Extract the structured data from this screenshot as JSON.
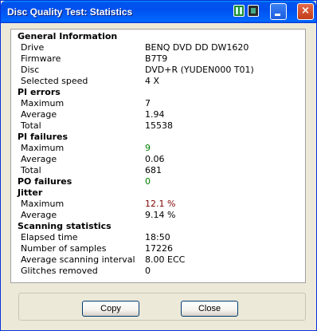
{
  "window": {
    "title": "Disc Quality Test: Statistics",
    "close_glyph": "×"
  },
  "rows": [
    {
      "type": "section",
      "label": "General Information"
    },
    {
      "type": "item",
      "label": "Drive",
      "value": "BENQ     DVD DD DW1620"
    },
    {
      "type": "item",
      "label": "Firmware",
      "value": "B7T9"
    },
    {
      "type": "item",
      "label": "Disc",
      "value": "DVD+R (YUDEN000 T01)"
    },
    {
      "type": "item",
      "label": "Selected speed",
      "value": "4 X"
    },
    {
      "type": "section",
      "label": "PI errors"
    },
    {
      "type": "item",
      "label": "Maximum",
      "value": "7"
    },
    {
      "type": "item",
      "label": "Average",
      "value": "1.94"
    },
    {
      "type": "item",
      "label": "Total",
      "value": "15538"
    },
    {
      "type": "section",
      "label": "PI failures"
    },
    {
      "type": "item",
      "label": "Maximum",
      "value": "9",
      "color": "green"
    },
    {
      "type": "item",
      "label": "Average",
      "value": "0.06"
    },
    {
      "type": "item",
      "label": "Total",
      "value": "681"
    },
    {
      "type": "section",
      "label": "PO failures",
      "value": "0",
      "color": "green"
    },
    {
      "type": "section",
      "label": "Jitter"
    },
    {
      "type": "item",
      "label": "Maximum",
      "value": "12.1 %",
      "color": "red"
    },
    {
      "type": "item",
      "label": "Average",
      "value": "9.14 %"
    },
    {
      "type": "section",
      "label": "Scanning statistics"
    },
    {
      "type": "item",
      "label": "Elapsed time",
      "value": "18:50"
    },
    {
      "type": "item",
      "label": "Number of samples",
      "value": "17226"
    },
    {
      "type": "item",
      "label": "Average scanning interval",
      "value": "8.00 ECC"
    },
    {
      "type": "item",
      "label": "Glitches removed",
      "value": "0"
    }
  ],
  "buttons": {
    "copy": "Copy",
    "close": "Close"
  },
  "colors": {
    "green": "#008000",
    "red": "#800000"
  }
}
